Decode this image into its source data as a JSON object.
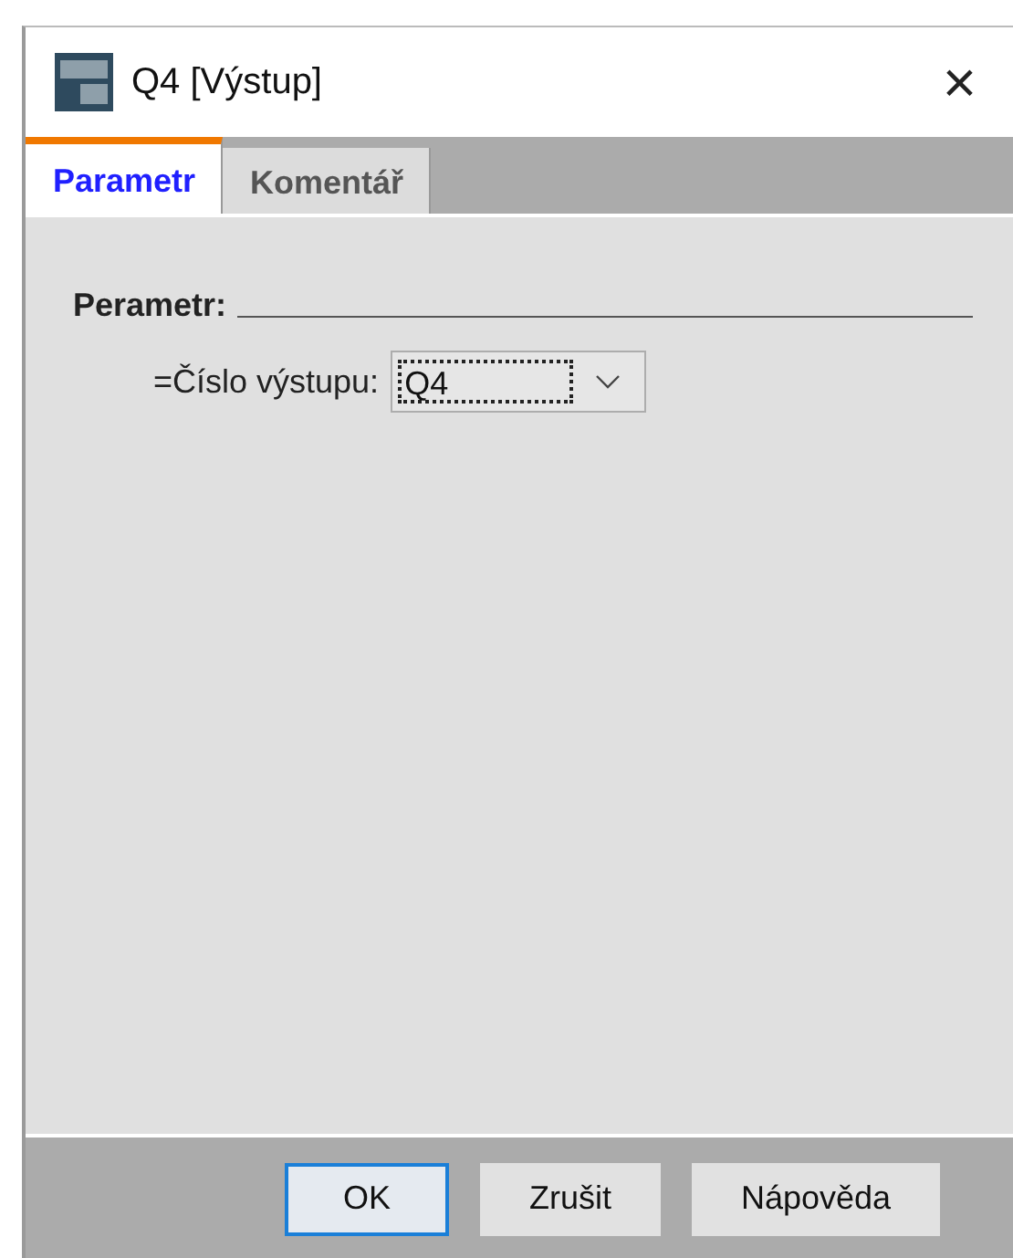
{
  "window": {
    "title": "Q4 [Výstup]",
    "close": "×"
  },
  "tabs": [
    {
      "label": "Parametr",
      "selected": true
    },
    {
      "label": "Komentář",
      "selected": false
    }
  ],
  "group": {
    "title": "Perametr:",
    "field": {
      "label": "=Číslo výstupu:",
      "value": "Q4",
      "focused": true
    }
  },
  "buttons": [
    {
      "label": "OK",
      "default": true
    },
    {
      "label": "Zrušit",
      "default": false
    },
    {
      "label": "Nápověda",
      "default": false
    }
  ]
}
